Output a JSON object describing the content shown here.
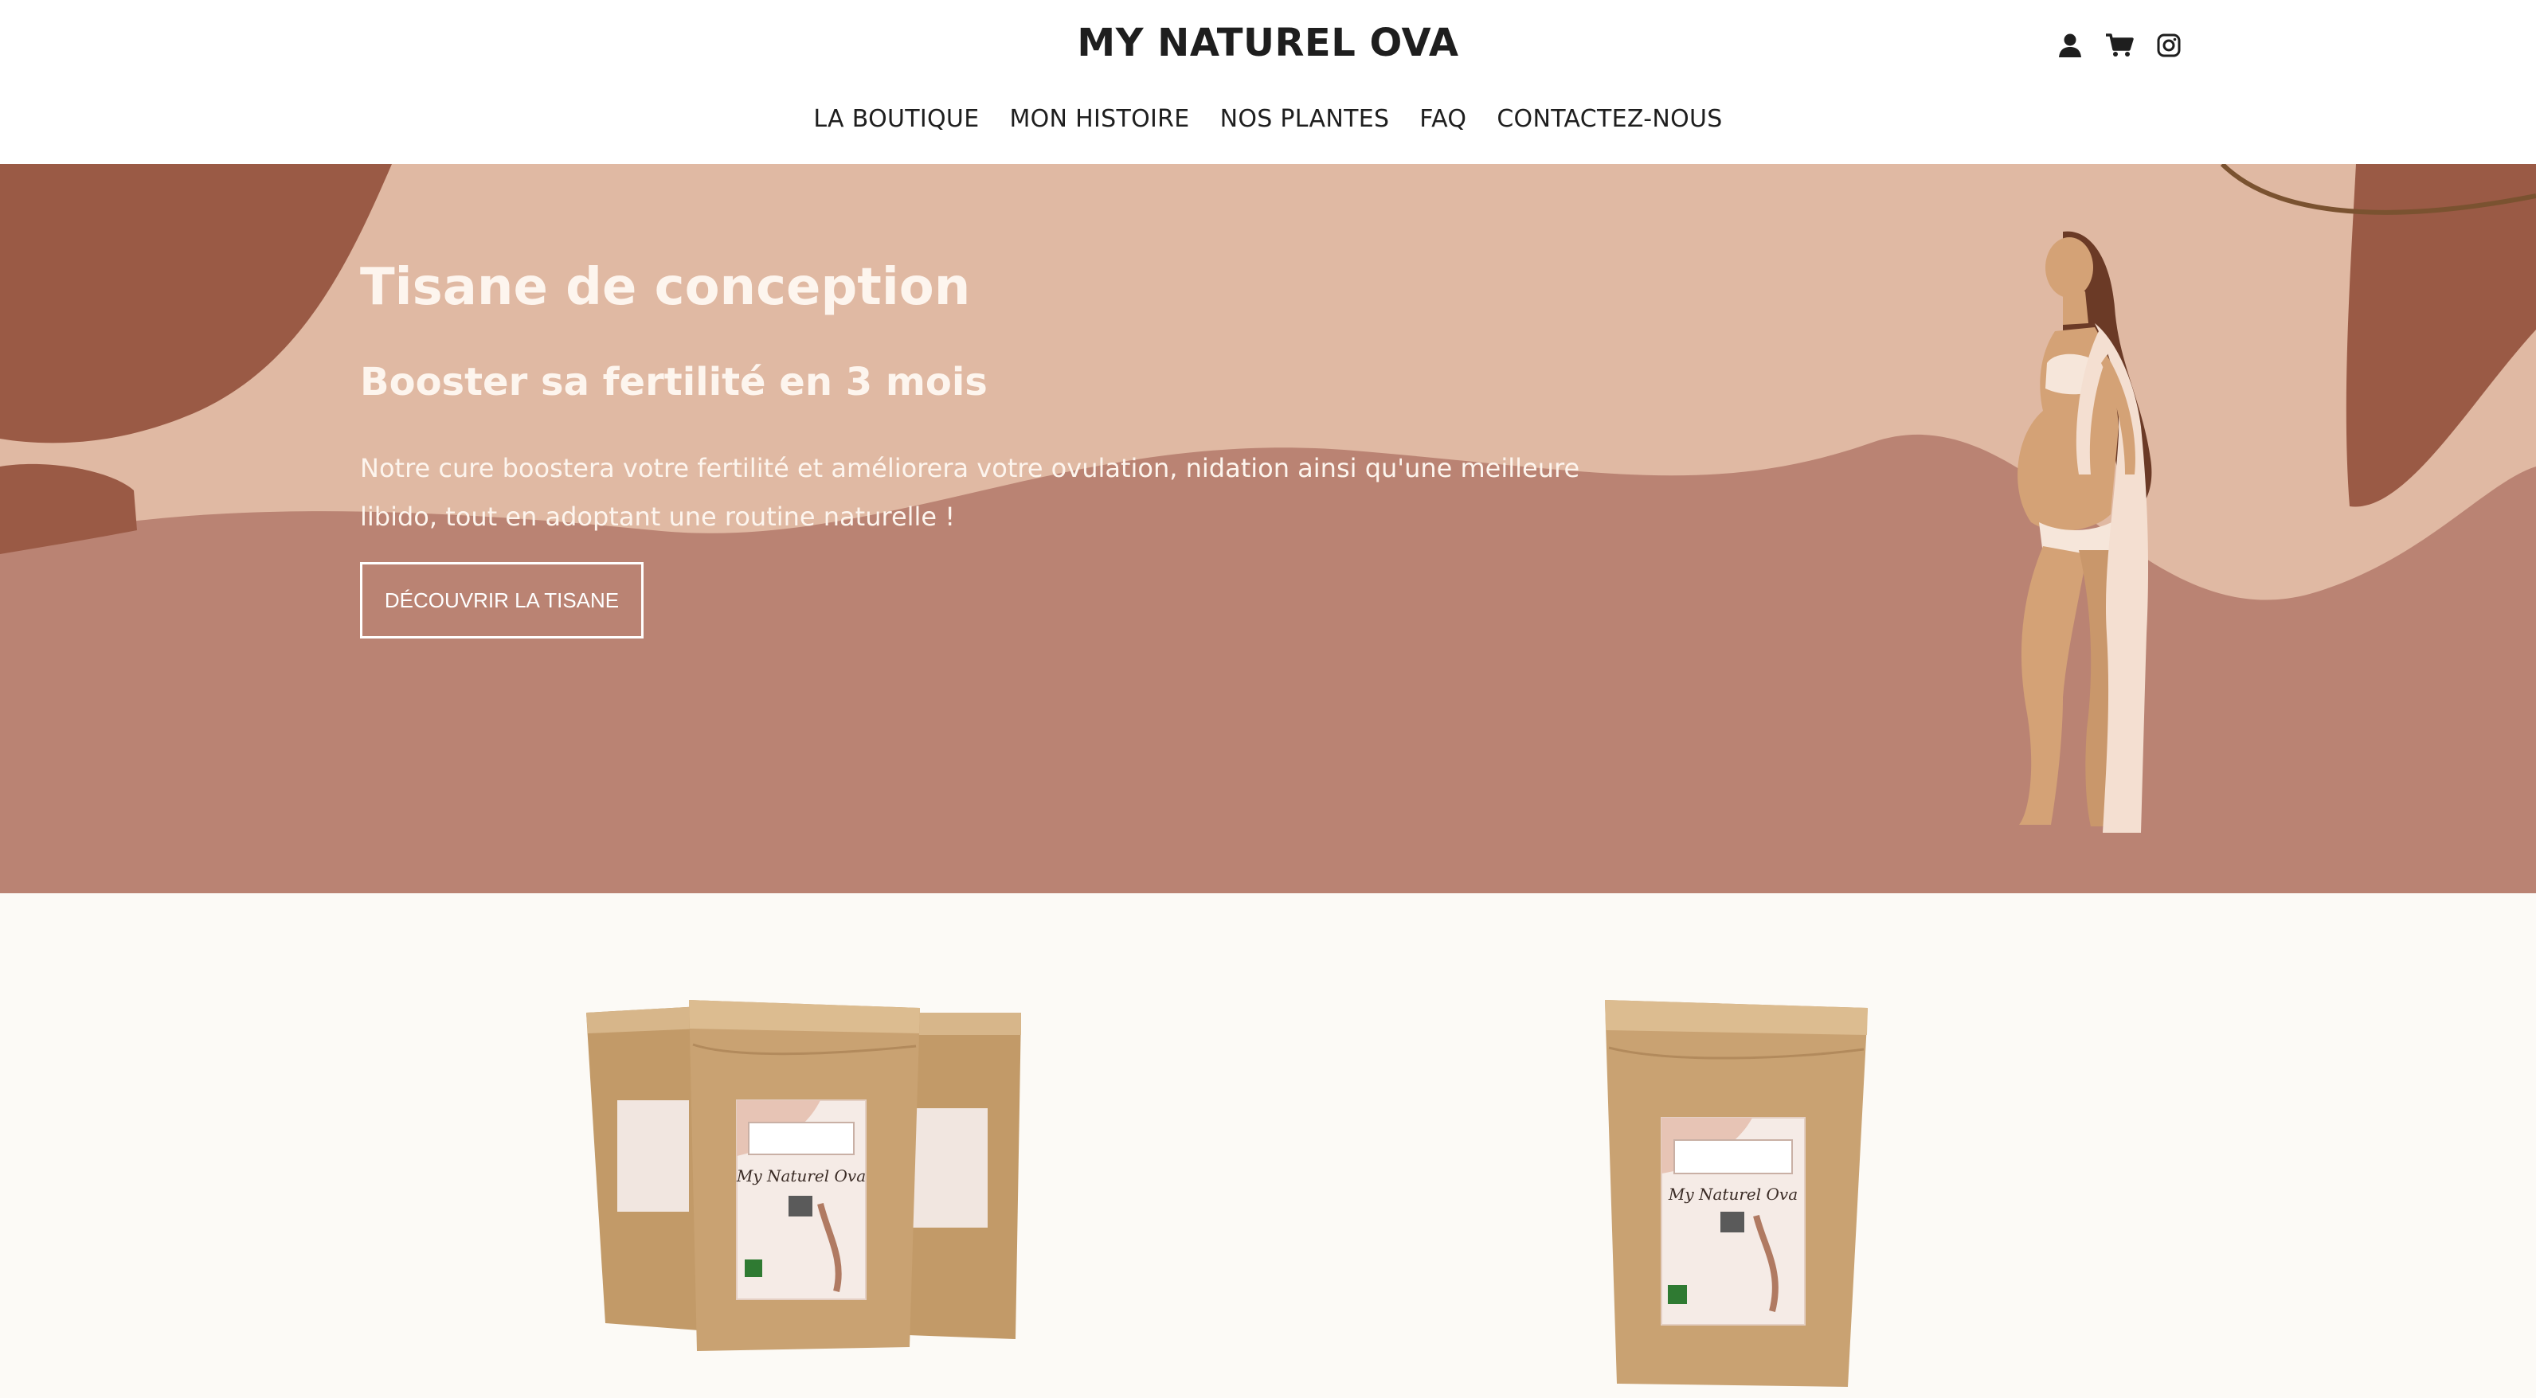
{
  "header": {
    "brand": "MY NATUREL OVA",
    "nav": [
      {
        "label": "LA BOUTIQUE"
      },
      {
        "label": "MON HISTOIRE"
      },
      {
        "label": "NOS PLANTES"
      },
      {
        "label": "FAQ"
      },
      {
        "label": "CONTACTEZ-NOUS"
      }
    ],
    "icons": [
      "user-icon",
      "cart-icon",
      "instagram-icon"
    ]
  },
  "hero": {
    "title": "Tisane de conception",
    "subtitle": "Booster sa fertilité en 3 mois",
    "text": "Notre cure boostera votre fertilité et améliorera votre ovulation, nidation ainsi qu'une meilleure libido, tout en adoptant une routine naturelle !",
    "button_label": "DÉCOUVRIR LA TISANE"
  },
  "products": {
    "label_brand": "My Naturel Ova"
  },
  "colors": {
    "hero_bg": "#e0b9a3",
    "hero_wave": "#ba8373",
    "hero_dark": "#9a5a45",
    "kraft": "#c7a070",
    "page_bg": "#fcfaf6"
  }
}
